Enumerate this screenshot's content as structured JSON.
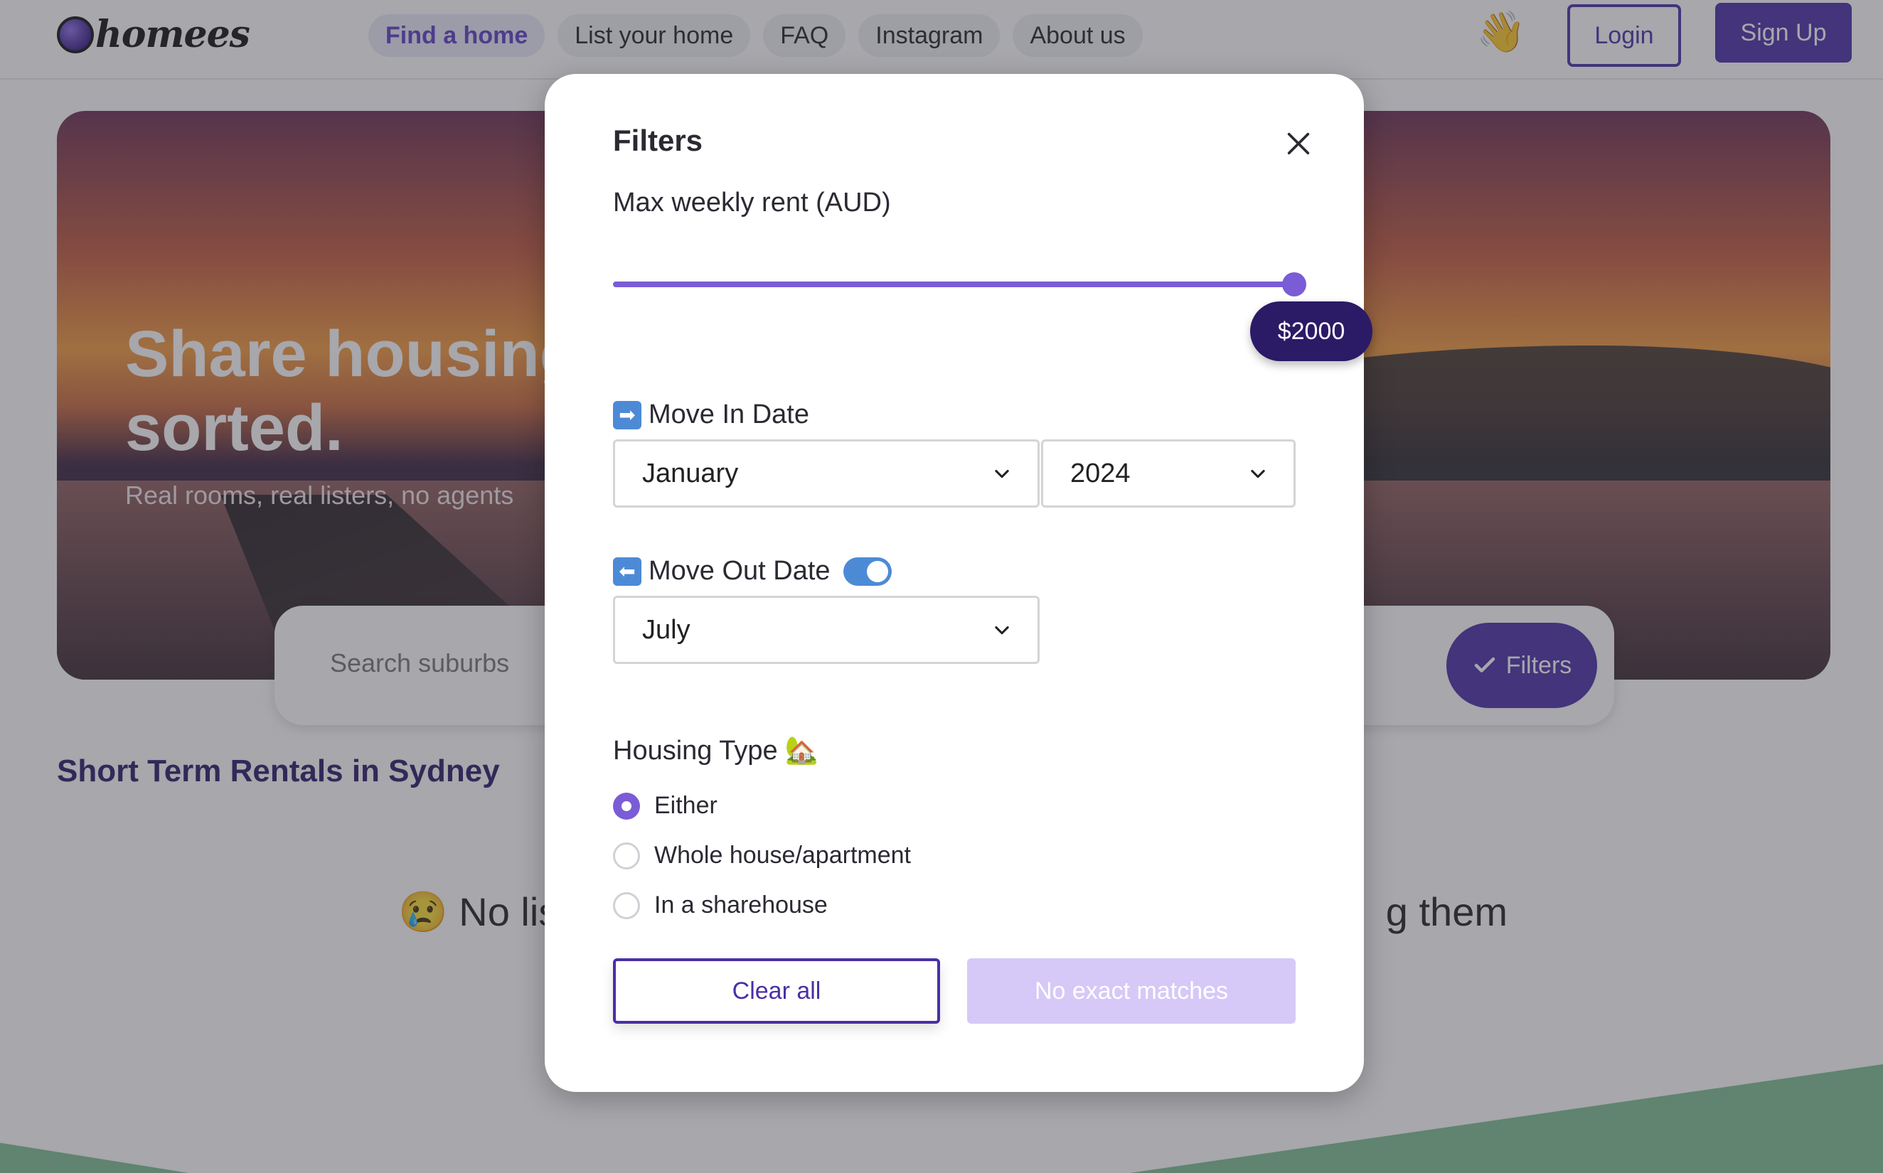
{
  "header": {
    "logo_text": "homees",
    "nav": [
      {
        "label": "Find a home",
        "active": true
      },
      {
        "label": "List your home"
      },
      {
        "label": "FAQ"
      },
      {
        "label": "Instagram"
      },
      {
        "label": "About us"
      }
    ],
    "wave_emoji": "👋",
    "login_label": "Login",
    "signup_label": "Sign Up"
  },
  "hero": {
    "title_line1": "Share housing",
    "title_line2": "sorted.",
    "subtitle": "Real rooms, real listers, no agents"
  },
  "search": {
    "placeholder": "Search suburbs",
    "filters_label": "Filters"
  },
  "section": {
    "title": "Short Term Rentals in Sydney",
    "empty_left": "😢 No lis",
    "empty_right": "g them"
  },
  "filters_modal": {
    "title": "Filters",
    "max_rent": {
      "label": "Max weekly rent (AUD)",
      "value_label": "$2000",
      "fraction": 1.0
    },
    "move_in": {
      "emoji": "➡",
      "label": "Move In Date",
      "month": "January",
      "year": "2024"
    },
    "move_out": {
      "emoji": "⬅",
      "label": "Move Out Date",
      "enabled": true,
      "month": "July"
    },
    "housing_type": {
      "label": "Housing Type",
      "emoji": "🏡",
      "options": [
        {
          "label": "Either",
          "checked": true
        },
        {
          "label": "Whole house/apartment",
          "checked": false
        },
        {
          "label": "In a sharehouse",
          "checked": false
        }
      ]
    },
    "clear_label": "Clear all",
    "apply_label": "No exact matches"
  },
  "colors": {
    "brand": "#4a2fa6",
    "accent": "#7a5cd6",
    "toggle": "#4d8ad6"
  }
}
